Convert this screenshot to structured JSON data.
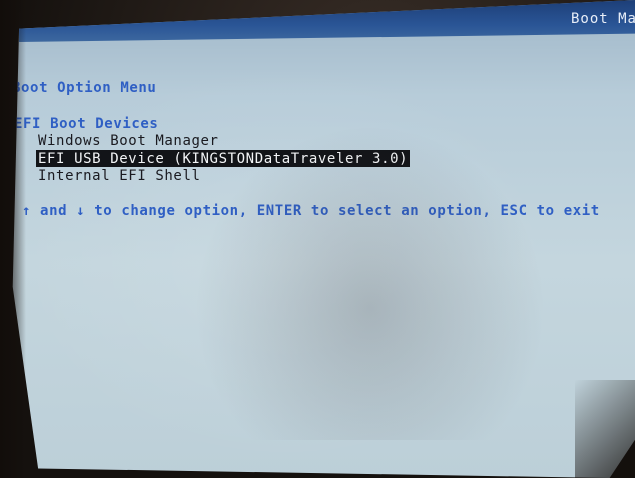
{
  "header": {
    "title": "Boot Ma"
  },
  "menu": {
    "title": "Boot Option Menu",
    "group_title": "EFI Boot Devices",
    "options": [
      {
        "label": "Windows Boot Manager",
        "selected": false
      },
      {
        "label": "EFI USB Device (KINGSTONDataTraveler 3.0)",
        "selected": true
      },
      {
        "label": "Internal EFI Shell",
        "selected": false
      }
    ]
  },
  "help": {
    "text": "↑ and ↓ to change option, ENTER to select an option, ESC to exit"
  },
  "colors": {
    "header_bar": "#2a5596",
    "screen_bg": "#c4d6de",
    "accent_text": "#2f5fc4",
    "highlight_bg": "#121418",
    "highlight_fg": "#f2f4f6"
  }
}
